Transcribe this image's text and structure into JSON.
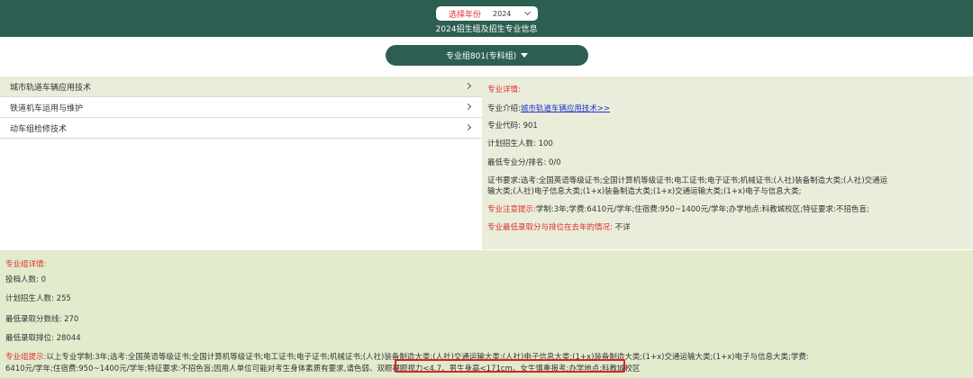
{
  "header": {
    "year_label": "选择年份",
    "year_value": "2024",
    "subtitle": "2024招生组及招生专业信息"
  },
  "group_button": {
    "label": "专业组801(专科组)"
  },
  "majors": [
    {
      "label": "城市轨道车辆应用技术",
      "active": true
    },
    {
      "label": "铁道机车运用与维护",
      "active": false
    },
    {
      "label": "动车组检修技术",
      "active": false
    }
  ],
  "detail": {
    "heading": "专业详情:",
    "intro_label": "专业介绍:",
    "intro_link": "城市轨道车辆应用技术>>",
    "code_label": "专业代码:",
    "code_value": "901",
    "plan_label": "计划招生人数:",
    "plan_value": "100",
    "min_rank_label": "最低专业分/排名:",
    "min_rank_value": "0/0",
    "cert_line1": "证书要求:选考:全国英语等级证书;全国计算机等级证书;电工证书;电子证书;机械证书;(人社)装备制造大类;(人社)交通运",
    "cert_line2": "输大类;(人社)电子信息大类;(1+x)装备制造大类;(1+x)交通运输大类;(1+x)电子与信息大类;",
    "notice_label": "专业注意提示:",
    "notice_value": "学制:3年;学费:6410元/学年;住宿费:950~1400元/学年;办学地点:科教城校区;特征要求:不招色盲;",
    "history_label": "专业最低录取分与排位在去年的情况:",
    "history_value": "不详"
  },
  "group_detail": {
    "heading": "专业组详情:",
    "filed_label": "投档人数:",
    "filed_value": "0",
    "plan_label": "计划招生人数:",
    "plan_value": "255",
    "min_score_label": "最低录取分数线:",
    "min_score_value": "270",
    "min_rank_label": "最低录取排位:",
    "min_rank_value": "28044",
    "tip_label": "专业组提示:",
    "tip_line1": "以上专业学制:3年;选考:全国英语等级证书;全国计算机等级证书;电工证书;电子证书;机械证书;(人社)装备制造大类;(人社)交通运输大类;(人社)电子信息大类;(1+x)装备制造大类;(1+x)交通运输大类;(1+x)电子与信息大类;学费:",
    "tip_line2_a": "6410元/学年;住宿费:950~1400元/学年;特征要求:不招色盲;因用人单位可能对考生身体素质有要求,",
    "tip_line2_b": "请色弱、双眼裸眼视力<4.7、男生身高<171cm、女生慎重报考;",
    "tip_line2_c": "办学地点:科教城校区"
  }
}
